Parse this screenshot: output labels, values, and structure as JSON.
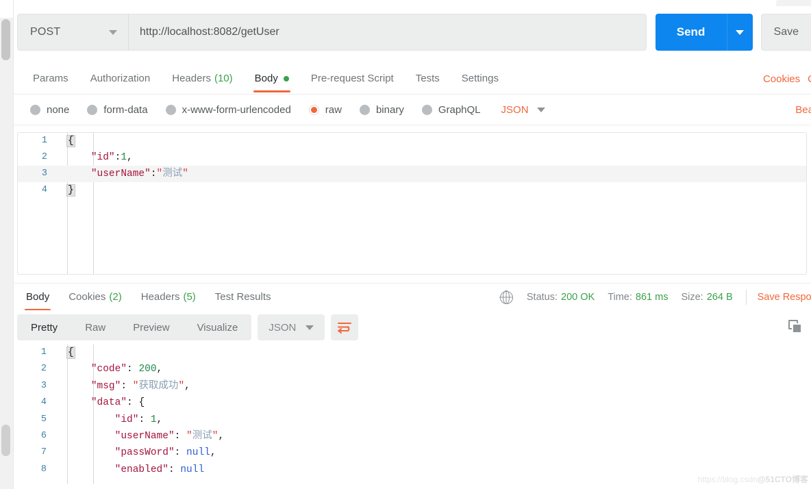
{
  "request": {
    "method": "POST",
    "url": "http://localhost:8082/getUser",
    "send_label": "Send",
    "save_label": "Save",
    "tabs": [
      {
        "label": "Params",
        "count": "",
        "active": false,
        "dot": false
      },
      {
        "label": "Authorization",
        "count": "",
        "active": false,
        "dot": false
      },
      {
        "label": "Headers",
        "count": "(10)",
        "active": false,
        "dot": false
      },
      {
        "label": "Body",
        "count": "",
        "active": true,
        "dot": true
      },
      {
        "label": "Pre-request Script",
        "count": "",
        "active": false,
        "dot": false
      },
      {
        "label": "Tests",
        "count": "",
        "active": false,
        "dot": false
      },
      {
        "label": "Settings",
        "count": "",
        "active": false,
        "dot": false
      }
    ],
    "tabs_right": [
      "Cookies",
      "C"
    ],
    "body_types": [
      {
        "label": "none",
        "checked": false
      },
      {
        "label": "form-data",
        "checked": false
      },
      {
        "label": "x-www-form-urlencoded",
        "checked": false
      },
      {
        "label": "raw",
        "checked": true
      },
      {
        "label": "binary",
        "checked": false
      },
      {
        "label": "GraphQL",
        "checked": false
      }
    ],
    "format": "JSON",
    "beautify_label": "Beautif",
    "body_lines": [
      {
        "n": "1",
        "highlight": false,
        "tokens": [
          {
            "t": "{",
            "c": "tk-brace tk-brace-box"
          }
        ]
      },
      {
        "n": "2",
        "highlight": false,
        "tokens": [
          {
            "t": "    ",
            "c": "tk-punc"
          },
          {
            "t": "\"id\"",
            "c": "tk-key"
          },
          {
            "t": ":",
            "c": "tk-punc"
          },
          {
            "t": "1",
            "c": "tk-num"
          },
          {
            "t": ",",
            "c": "tk-punc"
          }
        ]
      },
      {
        "n": "3",
        "highlight": true,
        "tokens": [
          {
            "t": "    ",
            "c": "tk-punc"
          },
          {
            "t": "\"userName\"",
            "c": "tk-key"
          },
          {
            "t": ":",
            "c": "tk-punc"
          },
          {
            "t": "\"",
            "c": "tk-str"
          },
          {
            "t": "测试",
            "c": "tk-cjk"
          },
          {
            "t": "\"",
            "c": "tk-str"
          }
        ]
      },
      {
        "n": "4",
        "highlight": false,
        "tokens": [
          {
            "t": "}",
            "c": "tk-brace tk-brace-box"
          }
        ]
      }
    ]
  },
  "response": {
    "tabs": [
      {
        "label": "Body",
        "count": "",
        "active": true
      },
      {
        "label": "Cookies",
        "count": "(2)",
        "active": false
      },
      {
        "label": "Headers",
        "count": "(5)",
        "active": false
      },
      {
        "label": "Test Results",
        "count": "",
        "active": false
      }
    ],
    "status_label": "Status:",
    "status_value": "200 OK",
    "time_label": "Time:",
    "time_value": "861 ms",
    "size_label": "Size:",
    "size_value": "264 B",
    "save_response_label": "Save Response",
    "view_modes": [
      {
        "label": "Pretty",
        "active": true
      },
      {
        "label": "Raw",
        "active": false
      },
      {
        "label": "Preview",
        "active": false
      },
      {
        "label": "Visualize",
        "active": false
      }
    ],
    "format": "JSON",
    "body_lines": [
      {
        "n": "1",
        "tokens": [
          {
            "t": "{",
            "c": "tk-brace tk-brace-box"
          }
        ]
      },
      {
        "n": "2",
        "tokens": [
          {
            "t": "    ",
            "c": "tk-punc"
          },
          {
            "t": "\"code\"",
            "c": "tk-key"
          },
          {
            "t": ": ",
            "c": "tk-punc"
          },
          {
            "t": "200",
            "c": "tk-num"
          },
          {
            "t": ",",
            "c": "tk-punc"
          }
        ]
      },
      {
        "n": "3",
        "tokens": [
          {
            "t": "    ",
            "c": "tk-punc"
          },
          {
            "t": "\"msg\"",
            "c": "tk-key"
          },
          {
            "t": ": ",
            "c": "tk-punc"
          },
          {
            "t": "\"",
            "c": "tk-str"
          },
          {
            "t": "获取成功",
            "c": "tk-cjk"
          },
          {
            "t": "\"",
            "c": "tk-str"
          },
          {
            "t": ",",
            "c": "tk-punc"
          }
        ]
      },
      {
        "n": "4",
        "tokens": [
          {
            "t": "    ",
            "c": "tk-punc"
          },
          {
            "t": "\"data\"",
            "c": "tk-key"
          },
          {
            "t": ": ",
            "c": "tk-punc"
          },
          {
            "t": "{",
            "c": "tk-brace"
          }
        ]
      },
      {
        "n": "5",
        "tokens": [
          {
            "t": "        ",
            "c": "tk-punc"
          },
          {
            "t": "\"id\"",
            "c": "tk-key"
          },
          {
            "t": ": ",
            "c": "tk-punc"
          },
          {
            "t": "1",
            "c": "tk-num"
          },
          {
            "t": ",",
            "c": "tk-punc"
          }
        ]
      },
      {
        "n": "6",
        "tokens": [
          {
            "t": "        ",
            "c": "tk-punc"
          },
          {
            "t": "\"userName\"",
            "c": "tk-key"
          },
          {
            "t": ": ",
            "c": "tk-punc"
          },
          {
            "t": "\"",
            "c": "tk-str"
          },
          {
            "t": "测试",
            "c": "tk-cjk"
          },
          {
            "t": "\"",
            "c": "tk-str"
          },
          {
            "t": ",",
            "c": "tk-punc"
          }
        ]
      },
      {
        "n": "7",
        "tokens": [
          {
            "t": "        ",
            "c": "tk-punc"
          },
          {
            "t": "\"passWord\"",
            "c": "tk-key"
          },
          {
            "t": ": ",
            "c": "tk-punc"
          },
          {
            "t": "null",
            "c": "tk-null"
          },
          {
            "t": ",",
            "c": "tk-punc"
          }
        ]
      },
      {
        "n": "8",
        "tokens": [
          {
            "t": "        ",
            "c": "tk-punc"
          },
          {
            "t": "\"enabled\"",
            "c": "tk-key"
          },
          {
            "t": ": ",
            "c": "tk-punc"
          },
          {
            "t": "null",
            "c": "tk-null"
          }
        ]
      }
    ]
  },
  "watermark": {
    "part1": "https://blog.csdn",
    "part2": "@51CTO博客"
  },
  "colors": {
    "accent": "#f2673a",
    "send": "#0d86ef",
    "green": "#3aa14c"
  }
}
